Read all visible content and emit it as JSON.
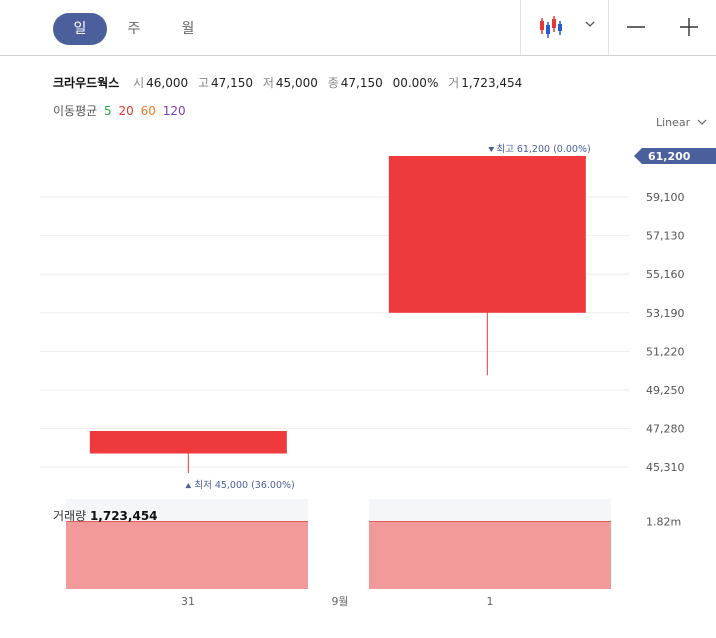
{
  "toolbar": {
    "period_tabs": [
      "일",
      "주",
      "월"
    ],
    "active_tab": 0,
    "chart_type_icon": "candlestick-icon",
    "chevron_icon": "chevron-down-icon",
    "zoom_out_icon": "minus-icon",
    "zoom_in_icon": "plus-icon"
  },
  "stock": {
    "name": "크라우드웍스",
    "open_label": "시",
    "open": "46,000",
    "high_label": "고",
    "high": "47,150",
    "low_label": "저",
    "low": "45,000",
    "close_label": "종",
    "close": "47,150",
    "change": "0",
    "change_pct": "0.00%",
    "volume_label": "거",
    "volume": "1,723,454"
  },
  "moving_average": {
    "label": "이동평균",
    "periods": [
      {
        "value": "5",
        "color": "#2aa84a"
      },
      {
        "value": "20",
        "color": "#e53935"
      },
      {
        "value": "60",
        "color": "#ef7a2a"
      },
      {
        "value": "120",
        "color": "#7b3fb5"
      }
    ]
  },
  "scale_selector": "Linear",
  "annotations": {
    "high": "최고 61,200 (0.00%)",
    "low": "최저 45,000 (36.00%)"
  },
  "last_price": "61,200",
  "volume_panel": {
    "label": "거래량",
    "value": "1,723,454",
    "axis_tick": "1.82m"
  },
  "colors": {
    "up": "#ee3a3c",
    "volume": "#f29a9a",
    "accent": "#4a5f9c"
  },
  "chart_data": {
    "type": "candlestick",
    "categories": [
      "31",
      "1"
    ],
    "x_tick_labels": [
      "31",
      "9월",
      "1"
    ],
    "candles": [
      {
        "date": "31",
        "open": 46000,
        "high": 47150,
        "low": 45000,
        "close": 47150
      },
      {
        "date": "1",
        "open": 53190,
        "high": 61200,
        "low": 50000,
        "close": 61200
      }
    ],
    "y_ticks": [
      "61,200",
      "59,100",
      "57,130",
      "55,160",
      "53,190",
      "51,220",
      "49,250",
      "47,280",
      "45,310"
    ],
    "ylim": [
      44500,
      61700
    ],
    "volume": [
      1723454,
      1723454
    ],
    "volume_ylim": [
      0,
      2300000
    ],
    "grid": true,
    "legend": "none"
  }
}
